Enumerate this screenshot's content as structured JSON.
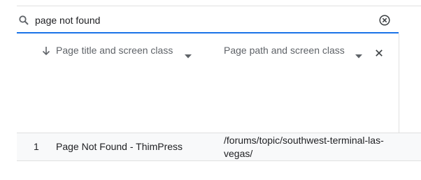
{
  "search": {
    "value": "page not found",
    "icon": "search-icon",
    "clear_icon": "clear-circle-icon",
    "accent_color": "#1a73e8"
  },
  "table": {
    "columns": [
      {
        "label": "Page title and screen class",
        "sort": "descending"
      },
      {
        "label": "Page path and screen class"
      }
    ],
    "rows": [
      {
        "index": "1",
        "title": "Page Not Found - ThimPress",
        "path": "/forums/topic/southwest-terminal-las-vegas/"
      }
    ]
  }
}
